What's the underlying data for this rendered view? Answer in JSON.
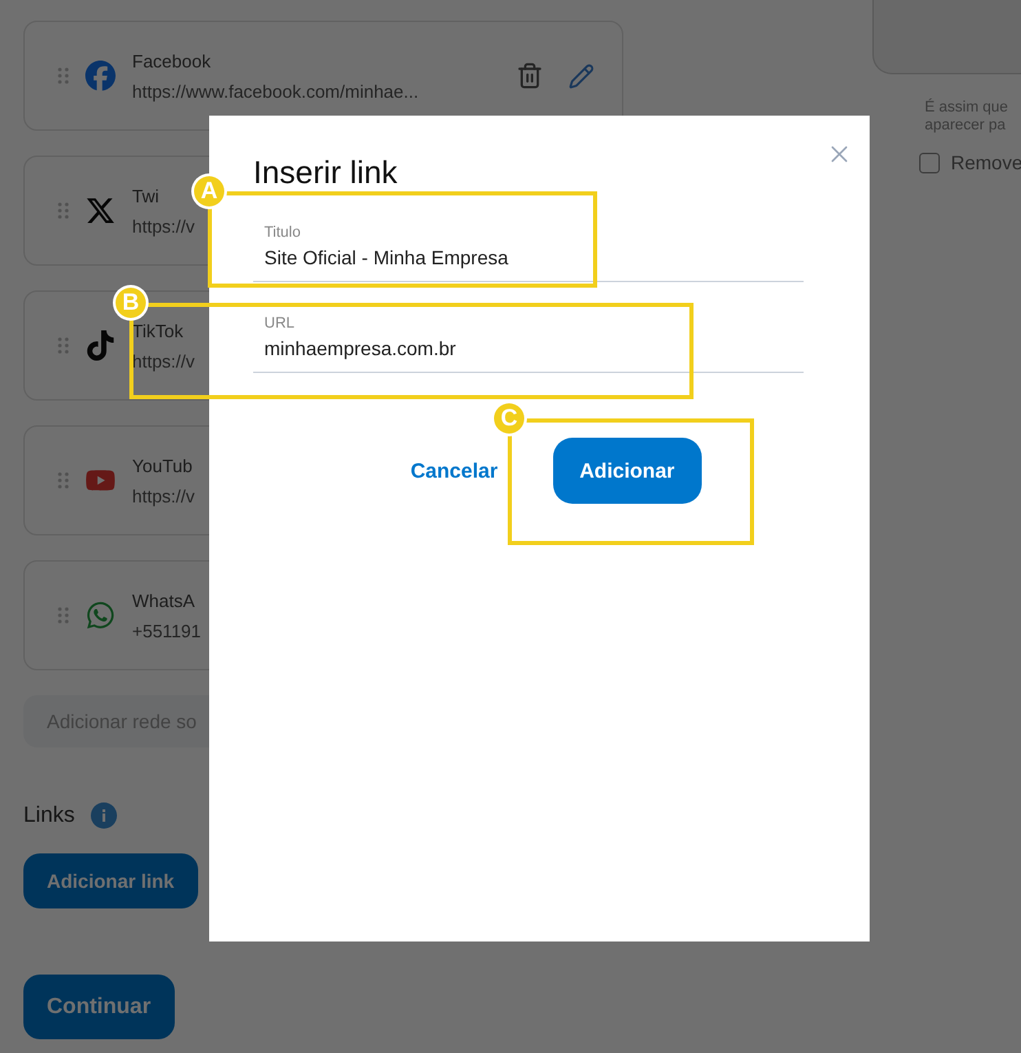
{
  "social_links": [
    {
      "kind": "facebook",
      "name": "Facebook",
      "url": "https://www.facebook.com/minhae..."
    },
    {
      "kind": "x",
      "name": "Twi",
      "url": "https://v"
    },
    {
      "kind": "tiktok",
      "name": "TikTok",
      "url": "https://v"
    },
    {
      "kind": "youtube",
      "name": "YouTub",
      "url": "https://v"
    },
    {
      "kind": "whatsapp",
      "name": "WhatsA",
      "url": "+551191"
    }
  ],
  "add_social_placeholder": "Adicionar rede so",
  "links_section": {
    "title": "Links",
    "add_button": "Adicionar link"
  },
  "continue_button": "Continuar",
  "preview": {
    "caption_lines": [
      "É assim que",
      "aparecer pa"
    ],
    "checkbox": {
      "label": "Remove",
      "checked": false
    }
  },
  "dialog": {
    "title": "Inserir link",
    "fields": [
      {
        "label": "Titulo",
        "value": "Site Oficial - Minha Empresa"
      },
      {
        "label": "URL",
        "value": "minhaempresa.com.br"
      }
    ],
    "cancel": "Cancelar",
    "submit": "Adicionar"
  },
  "annotations": [
    {
      "label": "A"
    },
    {
      "label": "B"
    },
    {
      "label": "C"
    }
  ]
}
